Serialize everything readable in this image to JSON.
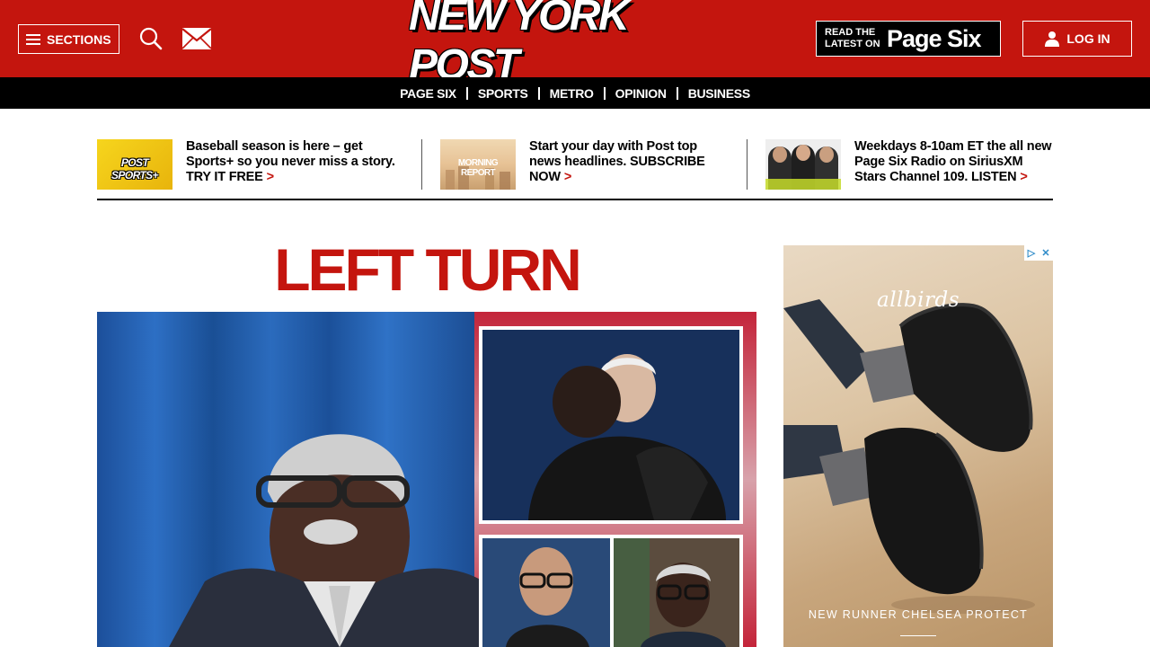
{
  "header": {
    "sections_label": "SECTIONS",
    "logo_text": "NEW YORK POST",
    "pagesix_promo": {
      "read_line1": "READ THE",
      "read_line2": "LATEST ON",
      "brand": "Page Six"
    },
    "login_label": "LOG IN"
  },
  "nav": {
    "items": [
      "PAGE SIX",
      "SPORTS",
      "METRO",
      "OPINION",
      "BUSINESS"
    ]
  },
  "promos": [
    {
      "thumb_text": "POST SPORTS+",
      "text": "Baseball season is here – get Sports+ so you never miss a story. TRY IT FREE"
    },
    {
      "thumb_text": "MORNING REPORT",
      "text": "Start your day with Post top news headlines. SUBSCRIBE NOW"
    },
    {
      "thumb_text": "",
      "text": "Weekdays 8-10am ET the all new Page Six Radio on SiriusXM Stars Channel 109. LISTEN"
    }
  ],
  "main": {
    "headline": "LEFT TURN"
  },
  "ad": {
    "brand": "allbirds",
    "caption": "NEW RUNNER CHELSEA PROTECT",
    "controls": [
      "▷",
      "✕"
    ]
  },
  "colors": {
    "brand_red": "#c4150e",
    "nav_black": "#000000",
    "ad_choices_blue": "#2e8bc9"
  },
  "icons": [
    "hamburger-icon",
    "search-icon",
    "mail-icon",
    "user-icon",
    "chevron-right-icon",
    "adchoices-icon",
    "close-icon"
  ]
}
